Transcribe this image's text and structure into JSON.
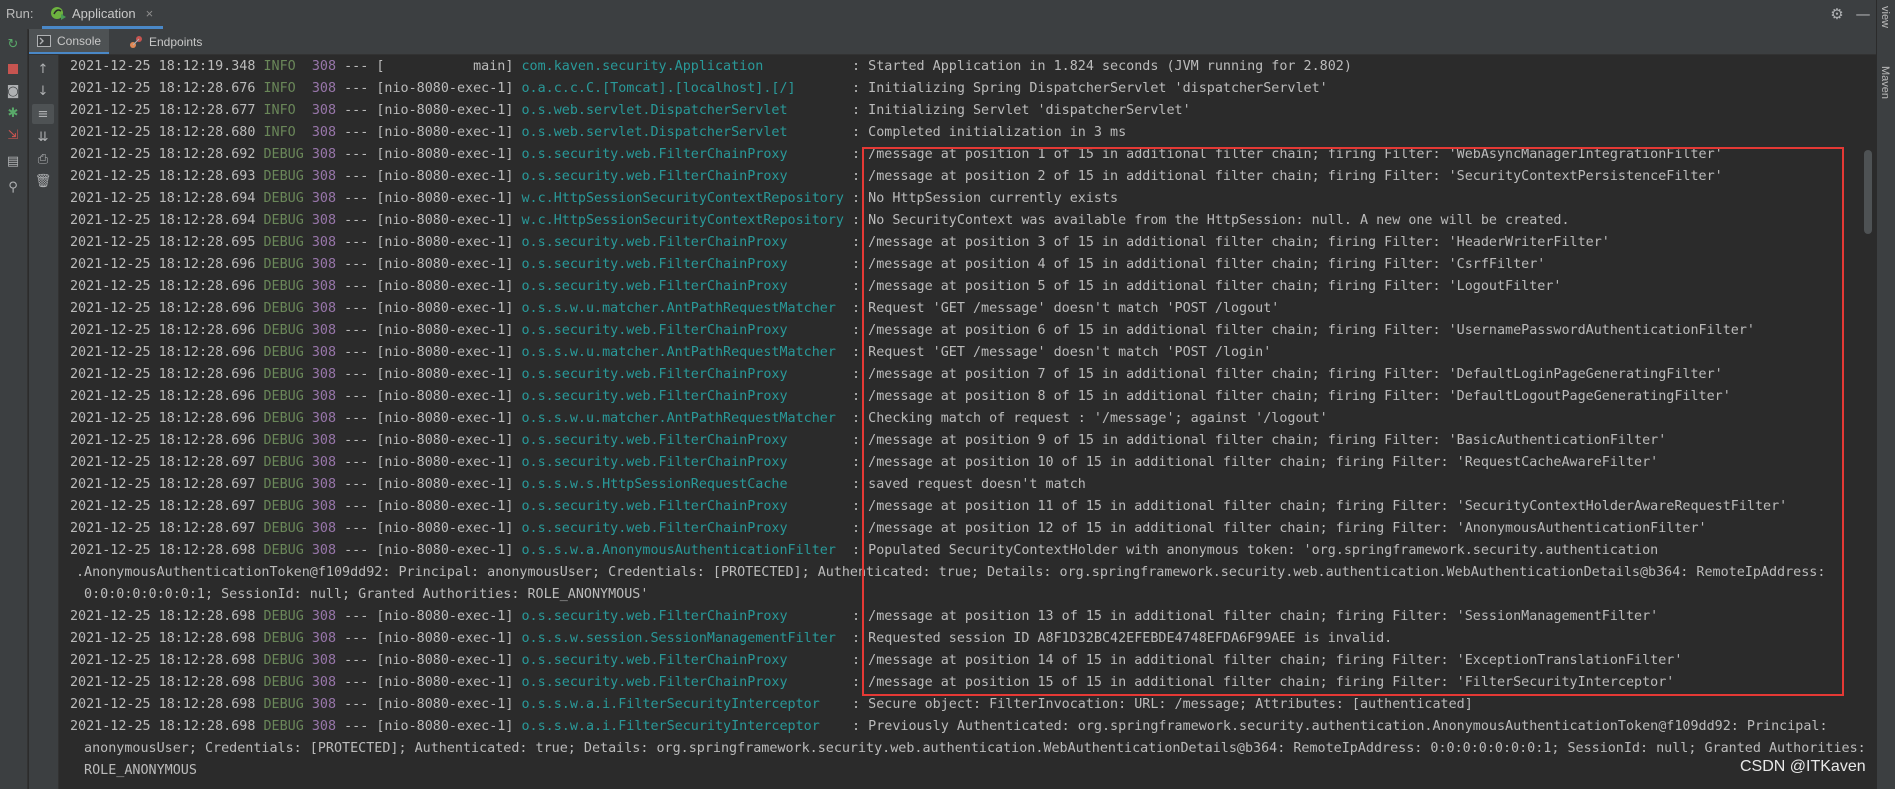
{
  "header": {
    "run_label": "Run:",
    "tab_label": "Application",
    "close_glyph": "×",
    "settings_icon": "gear-icon",
    "minimize_icon": "minus-icon"
  },
  "right_strip": {
    "items": [
      "view",
      "Maven"
    ]
  },
  "subtabs": [
    {
      "label": "Console",
      "active": true
    },
    {
      "label": "Endpoints",
      "active": false
    }
  ],
  "toolbar_icons": [
    "rerun-icon",
    "stop-icon",
    "camera-icon",
    "debug-icon",
    "export-icon",
    "layout-icon",
    "pin-icon"
  ],
  "console_toolbar_icons": [
    "arrow-up-icon",
    "arrow-down-icon",
    "soft-wrap-icon",
    "scroll-to-end-icon",
    "print-icon",
    "trash-icon"
  ],
  "log_lines": [
    {
      "ts": "2021-12-25 18:12:19.348",
      "level": "INFO ",
      "pid": "308",
      "thread": " --- [           main] ",
      "logger": "com.kaven.security.Application          ",
      "msg": " : Started Application in 1.824 seconds (JVM running for 2.802)"
    },
    {
      "ts": "2021-12-25 18:12:28.676",
      "level": "INFO ",
      "pid": "308",
      "thread": " --- [nio-8080-exec-1] ",
      "logger": "o.a.c.c.C.[Tomcat].[localhost].[/]      ",
      "msg": " : Initializing Spring DispatcherServlet 'dispatcherServlet'"
    },
    {
      "ts": "2021-12-25 18:12:28.677",
      "level": "INFO ",
      "pid": "308",
      "thread": " --- [nio-8080-exec-1] ",
      "logger": "o.s.web.servlet.DispatcherServlet       ",
      "msg": " : Initializing Servlet 'dispatcherServlet'"
    },
    {
      "ts": "2021-12-25 18:12:28.680",
      "level": "INFO ",
      "pid": "308",
      "thread": " --- [nio-8080-exec-1] ",
      "logger": "o.s.web.servlet.DispatcherServlet       ",
      "msg": " : Completed initialization in 3 ms"
    },
    {
      "ts": "2021-12-25 18:12:28.692",
      "level": "DEBUG",
      "pid": "308",
      "thread": " --- [nio-8080-exec-1] ",
      "logger": "o.s.security.web.FilterChainProxy       ",
      "msg": " : /message at position 1 of 15 in additional filter chain; firing Filter: 'WebAsyncManagerIntegrationFilter'"
    },
    {
      "ts": "2021-12-25 18:12:28.693",
      "level": "DEBUG",
      "pid": "308",
      "thread": " --- [nio-8080-exec-1] ",
      "logger": "o.s.security.web.FilterChainProxy       ",
      "msg": " : /message at position 2 of 15 in additional filter chain; firing Filter: 'SecurityContextPersistenceFilter'"
    },
    {
      "ts": "2021-12-25 18:12:28.694",
      "level": "DEBUG",
      "pid": "308",
      "thread": " --- [nio-8080-exec-1] ",
      "logger": "w.c.HttpSessionSecurityContextRepository",
      "msg": " : No HttpSession currently exists"
    },
    {
      "ts": "2021-12-25 18:12:28.694",
      "level": "DEBUG",
      "pid": "308",
      "thread": " --- [nio-8080-exec-1] ",
      "logger": "w.c.HttpSessionSecurityContextRepository",
      "msg": " : No SecurityContext was available from the HttpSession: null. A new one will be created."
    },
    {
      "ts": "2021-12-25 18:12:28.695",
      "level": "DEBUG",
      "pid": "308",
      "thread": " --- [nio-8080-exec-1] ",
      "logger": "o.s.security.web.FilterChainProxy       ",
      "msg": " : /message at position 3 of 15 in additional filter chain; firing Filter: 'HeaderWriterFilter'"
    },
    {
      "ts": "2021-12-25 18:12:28.696",
      "level": "DEBUG",
      "pid": "308",
      "thread": " --- [nio-8080-exec-1] ",
      "logger": "o.s.security.web.FilterChainProxy       ",
      "msg": " : /message at position 4 of 15 in additional filter chain; firing Filter: 'CsrfFilter'"
    },
    {
      "ts": "2021-12-25 18:12:28.696",
      "level": "DEBUG",
      "pid": "308",
      "thread": " --- [nio-8080-exec-1] ",
      "logger": "o.s.security.web.FilterChainProxy       ",
      "msg": " : /message at position 5 of 15 in additional filter chain; firing Filter: 'LogoutFilter'"
    },
    {
      "ts": "2021-12-25 18:12:28.696",
      "level": "DEBUG",
      "pid": "308",
      "thread": " --- [nio-8080-exec-1] ",
      "logger": "o.s.s.w.u.matcher.AntPathRequestMatcher ",
      "msg": " : Request 'GET /message' doesn't match 'POST /logout'"
    },
    {
      "ts": "2021-12-25 18:12:28.696",
      "level": "DEBUG",
      "pid": "308",
      "thread": " --- [nio-8080-exec-1] ",
      "logger": "o.s.security.web.FilterChainProxy       ",
      "msg": " : /message at position 6 of 15 in additional filter chain; firing Filter: 'UsernamePasswordAuthenticationFilter'"
    },
    {
      "ts": "2021-12-25 18:12:28.696",
      "level": "DEBUG",
      "pid": "308",
      "thread": " --- [nio-8080-exec-1] ",
      "logger": "o.s.s.w.u.matcher.AntPathRequestMatcher ",
      "msg": " : Request 'GET /message' doesn't match 'POST /login'"
    },
    {
      "ts": "2021-12-25 18:12:28.696",
      "level": "DEBUG",
      "pid": "308",
      "thread": " --- [nio-8080-exec-1] ",
      "logger": "o.s.security.web.FilterChainProxy       ",
      "msg": " : /message at position 7 of 15 in additional filter chain; firing Filter: 'DefaultLoginPageGeneratingFilter'"
    },
    {
      "ts": "2021-12-25 18:12:28.696",
      "level": "DEBUG",
      "pid": "308",
      "thread": " --- [nio-8080-exec-1] ",
      "logger": "o.s.security.web.FilterChainProxy       ",
      "msg": " : /message at position 8 of 15 in additional filter chain; firing Filter: 'DefaultLogoutPageGeneratingFilter'"
    },
    {
      "ts": "2021-12-25 18:12:28.696",
      "level": "DEBUG",
      "pid": "308",
      "thread": " --- [nio-8080-exec-1] ",
      "logger": "o.s.s.w.u.matcher.AntPathRequestMatcher ",
      "msg": " : Checking match of request : '/message'; against '/logout'"
    },
    {
      "ts": "2021-12-25 18:12:28.696",
      "level": "DEBUG",
      "pid": "308",
      "thread": " --- [nio-8080-exec-1] ",
      "logger": "o.s.security.web.FilterChainProxy       ",
      "msg": " : /message at position 9 of 15 in additional filter chain; firing Filter: 'BasicAuthenticationFilter'"
    },
    {
      "ts": "2021-12-25 18:12:28.697",
      "level": "DEBUG",
      "pid": "308",
      "thread": " --- [nio-8080-exec-1] ",
      "logger": "o.s.security.web.FilterChainProxy       ",
      "msg": " : /message at position 10 of 15 in additional filter chain; firing Filter: 'RequestCacheAwareFilter'"
    },
    {
      "ts": "2021-12-25 18:12:28.697",
      "level": "DEBUG",
      "pid": "308",
      "thread": " --- [nio-8080-exec-1] ",
      "logger": "o.s.s.w.s.HttpSessionRequestCache       ",
      "msg": " : saved request doesn't match"
    },
    {
      "ts": "2021-12-25 18:12:28.697",
      "level": "DEBUG",
      "pid": "308",
      "thread": " --- [nio-8080-exec-1] ",
      "logger": "o.s.security.web.FilterChainProxy       ",
      "msg": " : /message at position 11 of 15 in additional filter chain; firing Filter: 'SecurityContextHolderAwareRequestFilter'"
    },
    {
      "ts": "2021-12-25 18:12:28.697",
      "level": "DEBUG",
      "pid": "308",
      "thread": " --- [nio-8080-exec-1] ",
      "logger": "o.s.security.web.FilterChainProxy       ",
      "msg": " : /message at position 12 of 15 in additional filter chain; firing Filter: 'AnonymousAuthenticationFilter'"
    },
    {
      "ts": "2021-12-25 18:12:28.698",
      "level": "DEBUG",
      "pid": "308",
      "thread": " --- [nio-8080-exec-1] ",
      "logger": "o.s.s.w.a.AnonymousAuthenticationFilter ",
      "msg": " : Populated SecurityContextHolder with anonymous token: 'org.springframework.security.authentication"
    },
    {
      "cont": ".AnonymousAuthenticationToken@f109dd92: Principal: anonymousUser; Credentials: [PROTECTED]; Authenticated: true; Details: org.springframework.security.web.authentication.WebAuthenticationDetails@b364: RemoteIpAddress:"
    },
    {
      "cont": " 0:0:0:0:0:0:0:1; SessionId: null; Granted Authorities: ROLE_ANONYMOUS'"
    },
    {
      "ts": "2021-12-25 18:12:28.698",
      "level": "DEBUG",
      "pid": "308",
      "thread": " --- [nio-8080-exec-1] ",
      "logger": "o.s.security.web.FilterChainProxy       ",
      "msg": " : /message at position 13 of 15 in additional filter chain; firing Filter: 'SessionManagementFilter'"
    },
    {
      "ts": "2021-12-25 18:12:28.698",
      "level": "DEBUG",
      "pid": "308",
      "thread": " --- [nio-8080-exec-1] ",
      "logger": "o.s.s.w.session.SessionManagementFilter ",
      "msg": " : Requested session ID A8F1D32BC42EFEBDE4748EFDA6F99AEE is invalid."
    },
    {
      "ts": "2021-12-25 18:12:28.698",
      "level": "DEBUG",
      "pid": "308",
      "thread": " --- [nio-8080-exec-1] ",
      "logger": "o.s.security.web.FilterChainProxy       ",
      "msg": " : /message at position 14 of 15 in additional filter chain; firing Filter: 'ExceptionTranslationFilter'"
    },
    {
      "ts": "2021-12-25 18:12:28.698",
      "level": "DEBUG",
      "pid": "308",
      "thread": " --- [nio-8080-exec-1] ",
      "logger": "o.s.security.web.FilterChainProxy       ",
      "msg": " : /message at position 15 of 15 in additional filter chain; firing Filter: 'FilterSecurityInterceptor'"
    },
    {
      "ts": "2021-12-25 18:12:28.698",
      "level": "DEBUG",
      "pid": "308",
      "thread": " --- [nio-8080-exec-1] ",
      "logger": "o.s.s.w.a.i.FilterSecurityInterceptor   ",
      "msg": " : Secure object: FilterInvocation: URL: /message; Attributes: [authenticated]"
    },
    {
      "ts": "2021-12-25 18:12:28.698",
      "level": "DEBUG",
      "pid": "308",
      "thread": " --- [nio-8080-exec-1] ",
      "logger": "o.s.s.w.a.i.FilterSecurityInterceptor   ",
      "msg": " : Previously Authenticated: org.springframework.security.authentication.AnonymousAuthenticationToken@f109dd92: Principal:"
    },
    {
      "cont": " anonymousUser; Credentials: [PROTECTED]; Authenticated: true; Details: org.springframework.security.web.authentication.WebAuthenticationDetails@b364: RemoteIpAddress: 0:0:0:0:0:0:0:1; SessionId: null; Granted Authorities:"
    },
    {
      "cont": " ROLE_ANONYMOUS"
    }
  ],
  "watermark": "CSDN @ITKaven",
  "colors": {
    "highlight_box": "#e53935",
    "logger": "#299999",
    "level": "#6a8759",
    "pid": "#9876aa"
  }
}
